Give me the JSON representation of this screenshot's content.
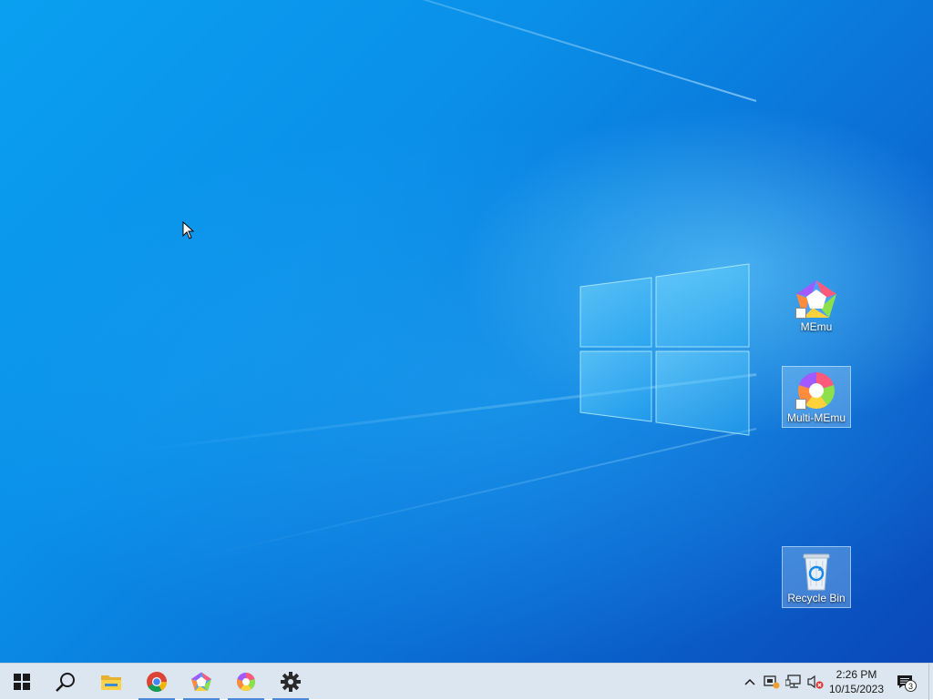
{
  "desktop": {
    "icons": [
      {
        "label": "MEmu",
        "icon": "memu-icon",
        "selected": false
      },
      {
        "label": "Multi-MEmu",
        "icon": "multi-memu-icon",
        "selected": true
      },
      {
        "label": "Recycle Bin",
        "icon": "recycle-bin-icon",
        "selected": true
      }
    ]
  },
  "taskbar": {
    "pinned": [
      {
        "name": "start",
        "icon": "windows-logo-icon",
        "active": false
      },
      {
        "name": "search",
        "icon": "search-icon",
        "active": false
      },
      {
        "name": "file-explorer",
        "icon": "folder-icon",
        "active": false
      },
      {
        "name": "chrome",
        "icon": "chrome-icon",
        "active": true
      },
      {
        "name": "memu",
        "icon": "memu-icon",
        "active": true
      },
      {
        "name": "multi-memu",
        "icon": "multi-memu-icon",
        "active": true
      },
      {
        "name": "settings",
        "icon": "gear-icon",
        "active": true
      }
    ],
    "tray": {
      "icons": [
        "chevron-up-icon",
        "memu-tray-icon",
        "network-icon",
        "volume-muted-icon"
      ],
      "time": "2:26 PM",
      "date": "10/15/2023",
      "notification_count": "3"
    }
  },
  "colors": {
    "taskbar_bg": "#dce6f0",
    "accent": "#4a8ad8",
    "desktop_base": "#0a8fe8"
  }
}
